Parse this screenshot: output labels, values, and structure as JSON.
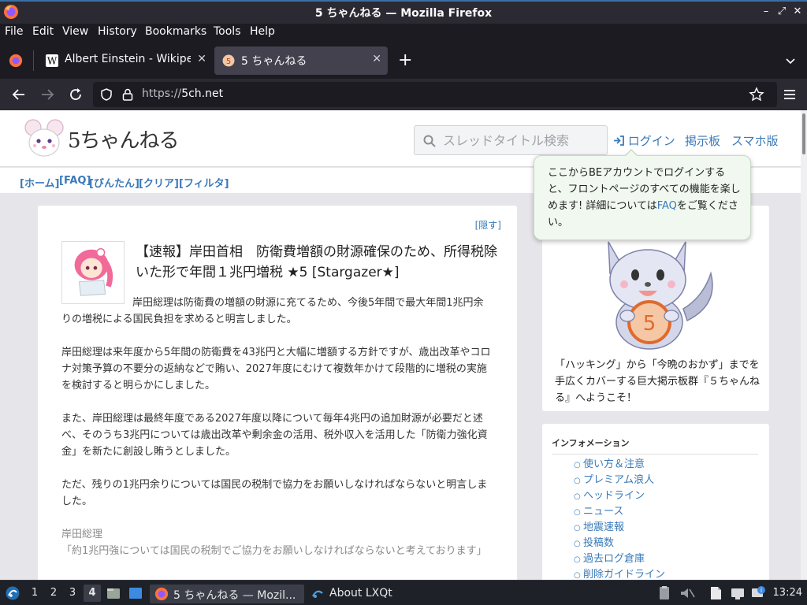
{
  "window": {
    "title": "5 ちゃんねる — Mozilla Firefox",
    "controls": {
      "minimize": "–",
      "restore": "⤢",
      "close": "✕"
    }
  },
  "menu": {
    "items": [
      {
        "label": "File"
      },
      {
        "label": "Edit"
      },
      {
        "label": "View"
      },
      {
        "label": "History"
      },
      {
        "label": "Bookmarks"
      },
      {
        "label": "Tools"
      },
      {
        "label": "Help"
      }
    ]
  },
  "tabs": [
    {
      "label": "Albert Einstein - Wikipedia",
      "favicon": "wikipedia-icon",
      "active": false
    },
    {
      "label": "5 ちゃんねる",
      "favicon": "5ch-icon",
      "active": true
    }
  ],
  "tabbar": {
    "new_tab": "+",
    "list_all": "⌄"
  },
  "navbar": {
    "url_scheme": "https://",
    "url_host": "5ch.net"
  },
  "site": {
    "logo_text": "5ちゃんねる",
    "search_placeholder": "スレッドタイトル検索",
    "links": {
      "login": "ログイン",
      "boards": "掲示板",
      "mobile": "スマホ版"
    },
    "subnav": [
      "[ホーム]",
      "[FAQ]",
      "[びんたん]",
      "[クリア]",
      "[フィルタ]"
    ]
  },
  "tooltip": {
    "text_before": "ここからBEアカウントでログインすると、フロントページのすべての機能を楽しめます! 詳細については",
    "link": "FAQ",
    "text_after": "をご覧ください。"
  },
  "article": {
    "hide_label": "[隠す]",
    "title": "【速報】岸田首相　防衛費増額の財源確保のため、所得税除いた形で年間１兆円増税 ★5 [Stargazer★]",
    "paragraphs": [
      "岸田総理は防衛費の増額の財源に充てるため、今後5年間で最大年間1兆円余りの増税による国民負担を求めると明言しました。",
      "岸田総理は来年度から5年間の防衛費を43兆円と大幅に増額する方針ですが、歳出改革やコロナ対策予算の不要分の返納などで賄い、2027年度にむけて複数年かけて段階的に増税の実施を検討すると明らかにしました。",
      "また、岸田総理は最終年度である2027年度以降について毎年4兆円の追加財源が必要だと述べ、そのうち3兆円については歳出改革や剰余金の活用、税外収入を活用した「防衛力強化資金」を新たに創設し賄うとしました。",
      "ただ、残りの1兆円余りについては国民の税制で協力をお願いしなければならないと明言しました。"
    ],
    "quote_speaker": "岸田総理",
    "quote_text": "「約1兆円強については国民の税制でご協力をお願いしなければならないと考えております」"
  },
  "sidebar": {
    "welcome": "「ハッキング」から「今晩のおかず」までを手広くカバーする巨大掲示板群『５ちゃんねる』へようこそ！",
    "info_heading": "インフォメーション",
    "info_items": [
      "使い方＆注意",
      "プレミアム浪人",
      "ヘッドライン",
      "ニュース",
      "地震速報",
      "投稿数",
      "過去ログ倉庫",
      "削除ガイドライン"
    ]
  },
  "taskbar": {
    "workspaces": [
      "1",
      "2",
      "3",
      "4"
    ],
    "active_workspace": "4",
    "tasks": [
      {
        "label": "5 ちゃんねる — Mozil...",
        "icon": "firefox-icon",
        "active": true
      },
      {
        "label": "About LXQt",
        "icon": "lxqt-icon",
        "active": false
      }
    ],
    "clock": "13:24"
  },
  "colors": {
    "link": "#3a7ab8",
    "tooltip_bg": "#f0f8ef",
    "chrome_dark": "#1c1b22",
    "chrome_mid": "#2b2a33",
    "page_bg": "#e6e6ea"
  }
}
